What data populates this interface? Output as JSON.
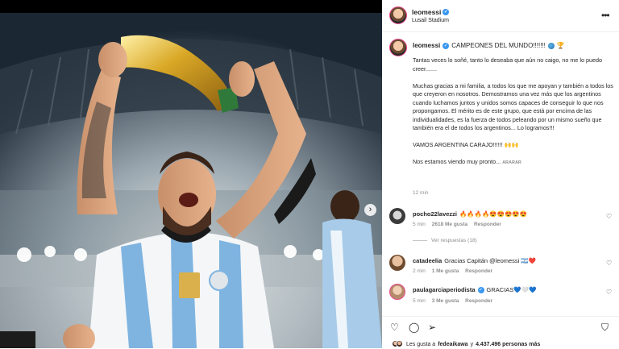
{
  "post": {
    "username": "leomessi",
    "location": "Lusail Stadium",
    "caption_title": "CAMPEONES DEL MUNDO!!!!!!!",
    "caption_paragraphs": [
      "Tantas veces lo soñé, tanto lo deseaba que aún no caigo, no me lo puedo creer.......",
      "Muchas gracias a mi familia, a todos los que me apoyan y también a todos los que creyeron en nosotros. Demostramos una vez más que los argentinos cuando luchamos juntos y unidos somos capaces de conseguir lo que nos propongamos. El mérito es de este grupo, que está por encima de las individualidades, es la fuerza de todos peleando por un mismo sueño que también era el de todos los argentinos... Lo logramos!!!",
      "VAMOS ARGENTINA CARAJO!!!!!! 🙌🙌",
      "Nos estamos viendo muy pronto..."
    ],
    "translate_label": "ARARAR",
    "time_ago": "12 min"
  },
  "comments": [
    {
      "username": "pocho22lavezzi",
      "text": "🔥🔥🔥🔥😍😍😍😍😍",
      "time": "5 min",
      "likes": "2618 Me gusta",
      "reply": "Responder",
      "view_replies": "Ver respuestas (18)"
    },
    {
      "username": "catadeelia",
      "text": "Gracias Capitán @leomessi 🇦🇷❤️",
      "time": "2 min",
      "likes": "1 Me gusta",
      "reply": "Responder"
    },
    {
      "username": "paulagarciaperiodista",
      "text": "GRACIAS💙🤍💙",
      "time": "5 min",
      "likes": "3 Me gusta",
      "reply": "Responder"
    }
  ],
  "likes_summary": {
    "prefix": "Les gusta a",
    "user": "fedeaikawa",
    "middle": "y",
    "count": "4.437.496 personas más"
  },
  "icons": [
    "more-icon",
    "verified-badge",
    "globe-icon",
    "trophy-icon",
    "heart-icon",
    "comment-icon",
    "share-icon",
    "bookmark-icon",
    "chevron-right-icon"
  ],
  "colors": {
    "accent_blue": "#3897f0",
    "secondary_text": "#8e8e8e",
    "story_ring": "#e64a8c"
  }
}
